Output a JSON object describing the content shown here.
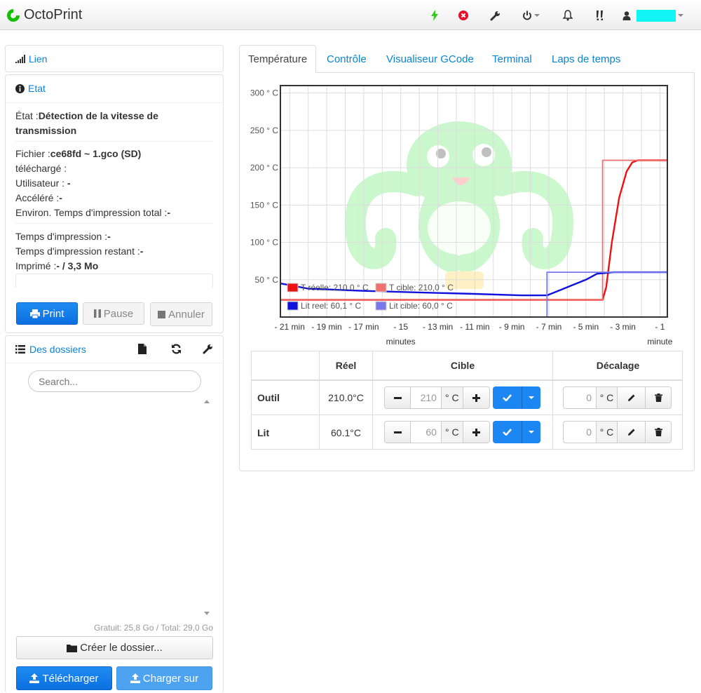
{
  "navbar": {
    "brand": "OctoPrint",
    "user_name": "",
    "icons": [
      "lightning-icon",
      "error-icon",
      "wrench-icon",
      "power-icon",
      "bell-icon",
      "warning-icon",
      "user-icon"
    ]
  },
  "connection": {
    "label": "Lien"
  },
  "state": {
    "title": "Etat",
    "status_label": "État :",
    "status_value_l1": "Détection de la vitesse de",
    "status_value_l2": "transmission",
    "file_label": "Fichier :",
    "file_value": "ce68fd ~ 1.gco (SD)",
    "uploaded_label": "téléchargé :",
    "user_label": "Utilisateur : ",
    "user_value": "-",
    "accelerated_label": "Accéléré :",
    "accelerated_value": "-",
    "est_total_label": "Environ. Temps d'impression total :",
    "est_total_value": "-",
    "print_time_label": "Temps d'impression :",
    "print_time_value": "-",
    "remaining_label": "Temps d'impression restant :",
    "remaining_value": "-",
    "printed_label": "Imprimé :",
    "printed_value": "- / 3,3 Mo",
    "btn_print": "Print",
    "btn_pause": "Pause",
    "btn_cancel": "Annuler"
  },
  "files": {
    "title": "Des dossiers",
    "search_placeholder": "Search...",
    "storage": "Gratuit: 25,8 Go / Total: 29,0 Go",
    "btn_create_folder": "Créer le dossier...",
    "btn_upload": "Télécharger",
    "btn_upload_to": "Charger sur"
  },
  "tabs": [
    "Température",
    "Contrôle",
    "Visualiseur GCode",
    "Terminal",
    "Laps de temps"
  ],
  "temperature_table": {
    "headers": {
      "actual": "Réel",
      "target": "Cible",
      "offset": "Décalage"
    },
    "unit": "° C",
    "rows": [
      {
        "name": "Outil",
        "actual": "210.0°C",
        "target": "210",
        "offset": "0"
      },
      {
        "name": "Lit",
        "actual": "60.1°C",
        "target": "60",
        "offset": "0"
      }
    ]
  },
  "chart_data": {
    "type": "line",
    "ylim": [
      0,
      310
    ],
    "xlim": [
      -21.5,
      -0.6
    ],
    "y_ticks": [
      {
        "value": 50,
        "label": "50 ° C"
      },
      {
        "value": 100,
        "label": "100 ° C"
      },
      {
        "value": 150,
        "label": "150 ° C"
      },
      {
        "value": 200,
        "label": "200 ° C"
      },
      {
        "value": 250,
        "label": "250 ° C"
      },
      {
        "value": 300,
        "label": "300 ° C"
      }
    ],
    "x_ticks": [
      {
        "value": -21,
        "label": "- 21 min"
      },
      {
        "value": -19,
        "label": "- 19 min"
      },
      {
        "value": -17,
        "label": "- 17 min"
      },
      {
        "value": -15,
        "label": "- 15"
      },
      {
        "value": -13,
        "label": "- 13 min"
      },
      {
        "value": -11,
        "label": "- 11 min"
      },
      {
        "value": -9,
        "label": "- 9 min"
      },
      {
        "value": -7,
        "label": "- 7 min"
      },
      {
        "value": -5,
        "label": "- 5 min"
      },
      {
        "value": -3,
        "label": "- 3 min"
      },
      {
        "value": -1,
        "label": "- 1"
      }
    ],
    "x_sublabels": [
      {
        "value": -15,
        "label": "minutes"
      },
      {
        "value": -1,
        "label": "minute"
      }
    ],
    "grid": true,
    "legend": [
      {
        "label": "T réelle: 210,0 ° C",
        "color": "#ee1111"
      },
      {
        "label": "T cible: 210,0 ° C",
        "color": "#f07070"
      },
      {
        "label": "Lit reel: 60,1 ° C",
        "color": "#1111dd"
      },
      {
        "label": "Lit cible: 60,0 ° C",
        "color": "#7777ee"
      }
    ],
    "series": [
      {
        "name": "T réelle: 210,0 ° C",
        "color": "#ee1111",
        "x": [
          -21.5,
          -7,
          -4.1,
          -3.9,
          -3.6,
          -3.2,
          -2.8,
          -2.5,
          -2.2,
          -1.8,
          -1.2,
          -0.6
        ],
        "y": [
          23,
          23,
          23,
          40,
          100,
          160,
          195,
          207,
          210,
          210,
          210,
          210
        ]
      },
      {
        "name": "T cible: 210,0 ° C",
        "color": "#f07070",
        "x": [
          -21.5,
          -4.1,
          -4.1,
          -0.6
        ],
        "y": [
          23,
          23,
          210,
          210
        ]
      },
      {
        "name": "Lit reel: 60,1 ° C",
        "color": "#1111dd",
        "x": [
          -21.5,
          -20,
          -17,
          -14,
          -11,
          -8.5,
          -7.1,
          -6.5,
          -5.8,
          -5,
          -4.4,
          -3.5,
          -2,
          -0.6
        ],
        "y": [
          45,
          38,
          35,
          33,
          31,
          29,
          29,
          35,
          42,
          50,
          58,
          60,
          60,
          60
        ]
      },
      {
        "name": "Lit cible: 60,0 ° C",
        "color": "#7777ee",
        "x": [
          -21.5,
          -7.1,
          -7.1,
          -0.6
        ],
        "y": [
          0,
          0,
          60,
          60
        ]
      }
    ]
  }
}
